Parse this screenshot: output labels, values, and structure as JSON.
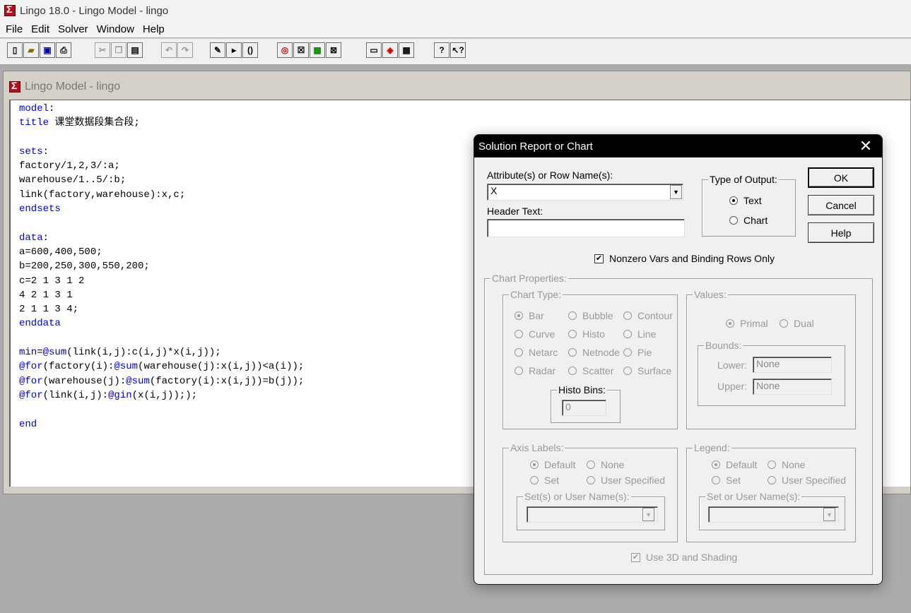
{
  "app": {
    "title": "Lingo 18.0 - Lingo Model - lingo",
    "menu": [
      "File",
      "Edit",
      "Solver",
      "Window",
      "Help"
    ]
  },
  "toolbar": {
    "icons": [
      "new-file-icon",
      "open-file-icon",
      "save-icon",
      "print-icon",
      "cut-icon",
      "copy-icon",
      "paste-icon",
      "undo-icon",
      "redo-icon",
      "find-icon",
      "goto-line-icon",
      "match-paren-icon",
      "solve-icon",
      "solution-icon",
      "matrix-picture-icon",
      "close-all-icon",
      "tile-icon",
      "send-to-back-icon",
      "cascade-icon",
      "help-icon",
      "context-help-icon"
    ]
  },
  "model_window": {
    "title": "Lingo Model - lingo",
    "code_lines": [
      "model:",
      "title 课堂数据段集合段;",
      "",
      "sets:",
      "factory/1,2,3/:a;",
      "warehouse/1..5/:b;",
      "link(factory,warehouse):x,c;",
      "endsets",
      "",
      "data:",
      "a=600,400,500;",
      "b=200,250,300,550,200;",
      "c=2 1 3 1 2",
      "4 2 1 3 1",
      "2 1 1 3 4;",
      "enddata",
      "",
      "min=@sum(link(i,j):c(i,j)*x(i,j));",
      "@for(factory(i):@sum(warehouse(j):x(i,j))<a(i));",
      "@for(warehouse(j):@sum(factory(i):x(i,j))=b(j));",
      "@for(link(i,j):@gin(x(i,j)););",
      "",
      "end"
    ]
  },
  "dialog": {
    "title": "Solution Report or Chart",
    "attribute_label": "Attribute(s) or Row Name(s):",
    "attribute_value": "X",
    "header_label": "Header Text:",
    "header_value": "",
    "output_type": {
      "title": "Type of Output:",
      "text": "Text",
      "chart": "Chart",
      "selected": "Text"
    },
    "buttons": {
      "ok": "OK",
      "cancel": "Cancel",
      "help": "Help"
    },
    "nonzero_label": "Nonzero Vars and Binding Rows Only",
    "nonzero_checked": true,
    "chart_properties": {
      "title": "Chart Properties:",
      "chart_type": {
        "title": "Chart Type:",
        "options": [
          "Bar",
          "Bubble",
          "Contour",
          "Curve",
          "Histo",
          "Line",
          "Netarc",
          "Netnode",
          "Pie",
          "Radar",
          "Scatter",
          "Surface"
        ],
        "selected": "Bar"
      },
      "histo_bins": {
        "label": "Histo Bins:",
        "value": "0"
      },
      "values": {
        "title": "Values:",
        "primal": "Primal",
        "dual": "Dual",
        "selected": "Primal",
        "bounds": {
          "title": "Bounds:",
          "lower_label": "Lower:",
          "lower_value": "None",
          "upper_label": "Upper:",
          "upper_value": "None"
        }
      },
      "axis_labels": {
        "title": "Axis Labels:",
        "default": "Default",
        "none": "None",
        "set": "Set",
        "user": "User Specified",
        "selected": "Default",
        "names_label": "Set(s) or User Name(s):"
      },
      "legend": {
        "title": "Legend:",
        "default": "Default",
        "none": "None",
        "set": "Set",
        "user": "User Specified",
        "selected": "Default",
        "names_label": "Set or User Name(s):"
      },
      "use_3d_label": "Use 3D and Shading",
      "use_3d_checked": true
    }
  }
}
